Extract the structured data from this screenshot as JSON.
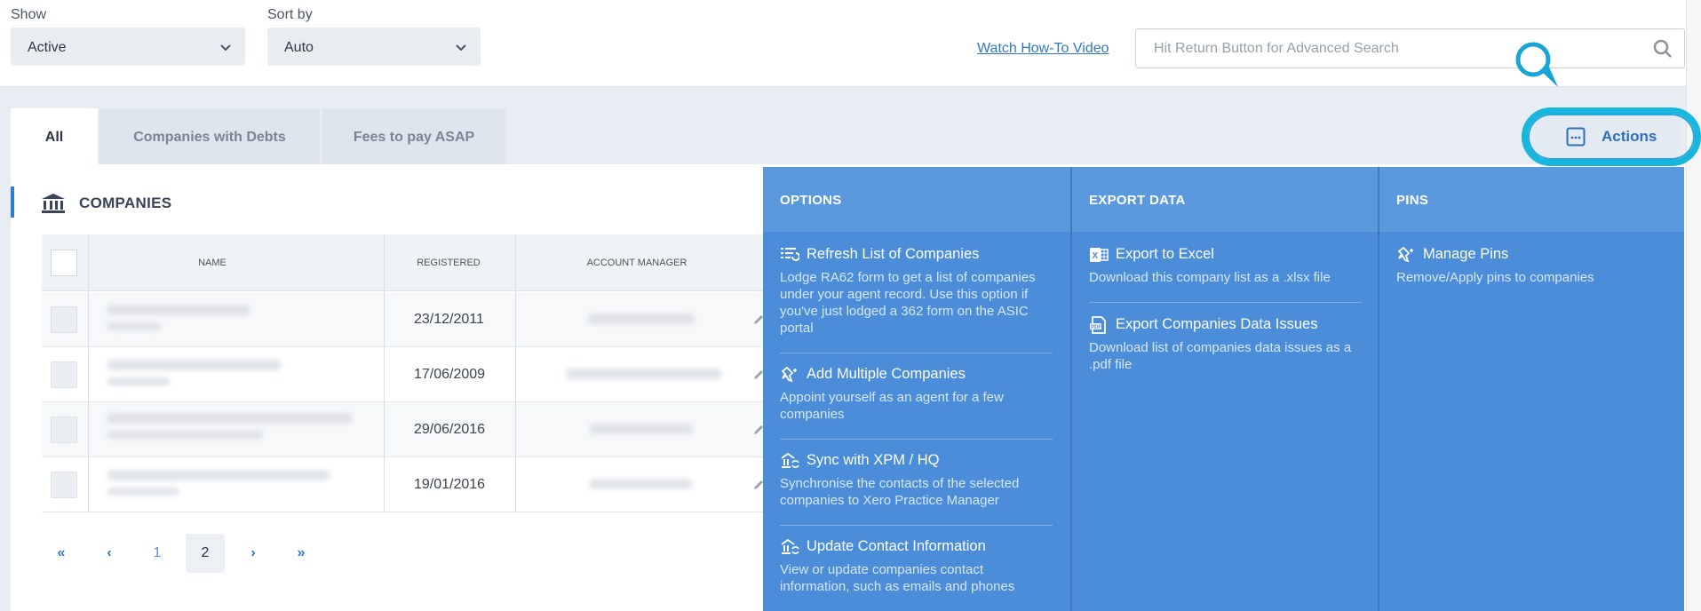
{
  "filters": {
    "show_label": "Show",
    "show_value": "Active",
    "sort_label": "Sort by",
    "sort_value": "Auto"
  },
  "howto_link": "Watch How-To Video",
  "search": {
    "placeholder": "Hit Return Button for Advanced Search",
    "icon": "search-icon"
  },
  "tabs": [
    {
      "label": "All",
      "active": true
    },
    {
      "label": "Companies with Debts",
      "active": false
    },
    {
      "label": "Fees to pay ASAP",
      "active": false
    }
  ],
  "actions": {
    "label": "Actions",
    "icon": "more-horizontal-square-icon"
  },
  "panel": {
    "title": "COMPANIES",
    "icon": "bank-icon"
  },
  "table": {
    "columns": [
      "NAME",
      "REGISTERED",
      "ACCOUNT MANAGER"
    ],
    "rows": [
      {
        "registered": "23/12/2011"
      },
      {
        "registered": "17/06/2009"
      },
      {
        "registered": "29/06/2016"
      },
      {
        "registered": "19/01/2016"
      }
    ]
  },
  "pagination": {
    "first": "«",
    "prev": "‹",
    "pages": [
      "1",
      "2"
    ],
    "current": "2",
    "next": "›",
    "last": "»"
  },
  "menu": {
    "options": {
      "heading": "OPTIONS",
      "items": [
        {
          "title": "Refresh List of Companies",
          "desc": "Lodge RA62 form to get a list of companies under your agent record. Use this option if you've just lodged a 362 form on the ASIC portal",
          "icon": "list-refresh-icon"
        },
        {
          "title": "Add Multiple Companies",
          "desc": "Appoint yourself as an agent for a few companies",
          "icon": "pin-sparkle-icon"
        },
        {
          "title": "Sync with XPM / HQ",
          "desc": "Synchronise the contacts of the selected companies to Xero Practice Manager",
          "icon": "sync-building-icon"
        },
        {
          "title": "Update Contact Information",
          "desc": "View or update companies contact information, such as emails and phones",
          "icon": "contact-update-icon"
        }
      ]
    },
    "export": {
      "heading": "EXPORT DATA",
      "items": [
        {
          "title": "Export to Excel",
          "desc": "Download this company list as a .xlsx file",
          "icon": "excel-icon"
        },
        {
          "title": "Export Companies Data Issues",
          "desc": "Download list of companies data issues as a .pdf file",
          "icon": "pdf-icon"
        }
      ]
    },
    "pins": {
      "heading": "PINS",
      "items": [
        {
          "title": "Manage Pins",
          "desc": "Remove/Apply pins to companies",
          "icon": "pin-sparkle-icon"
        }
      ]
    }
  },
  "colors": {
    "accent": "#2e79c7",
    "menu_bg": "#4b8dd9",
    "highlight_ring": "#17b6dc"
  }
}
